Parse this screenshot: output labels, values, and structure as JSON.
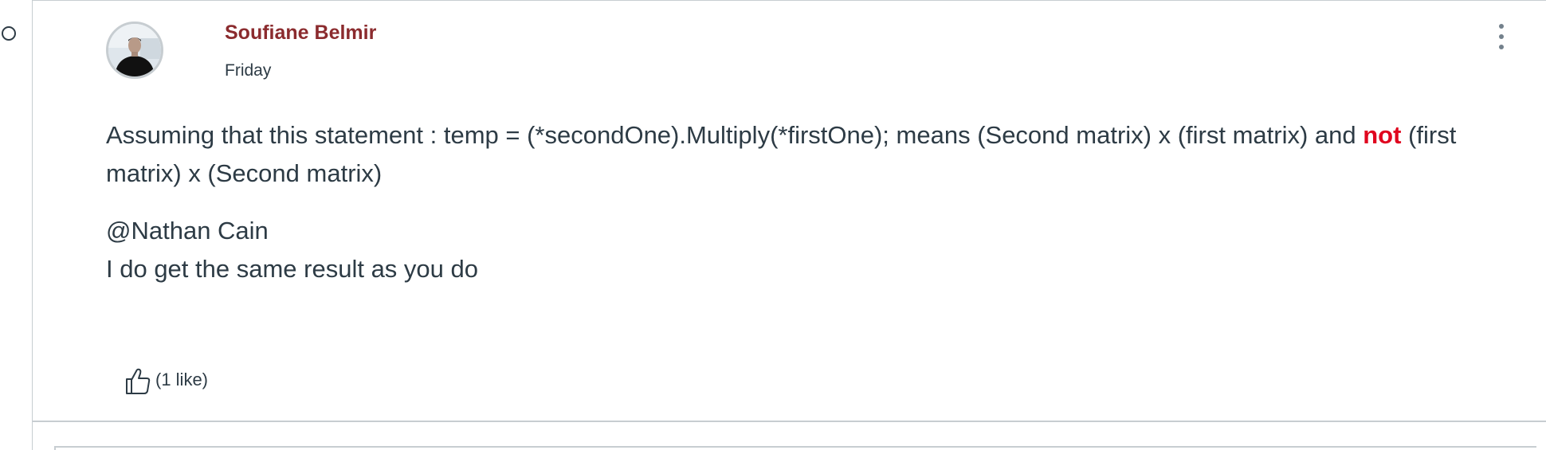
{
  "entry": {
    "author": "Soufiane Belmir",
    "date": "Friday",
    "message": {
      "p1_before": "Assuming that this statement : temp = (*secondOne).Multiply(*firstOne);  means (Second matrix) x (first matrix) and ",
      "p1_emphasis": "not",
      "p1_after": " (first matrix) x (Second matrix)",
      "mention": "@Nathan Cain",
      "p2": "I do get the same result as you do"
    },
    "likes_label": "(1 like)",
    "likes_count": 1
  },
  "icons": {
    "unread": "unread-circle-icon",
    "menu": "kebab-menu-icon",
    "like": "thumbs-up-icon"
  },
  "colors": {
    "author": "#8b2b2e",
    "text": "#2d3b45",
    "emphasis": "#e0061f",
    "border": "#c7cdd1"
  }
}
